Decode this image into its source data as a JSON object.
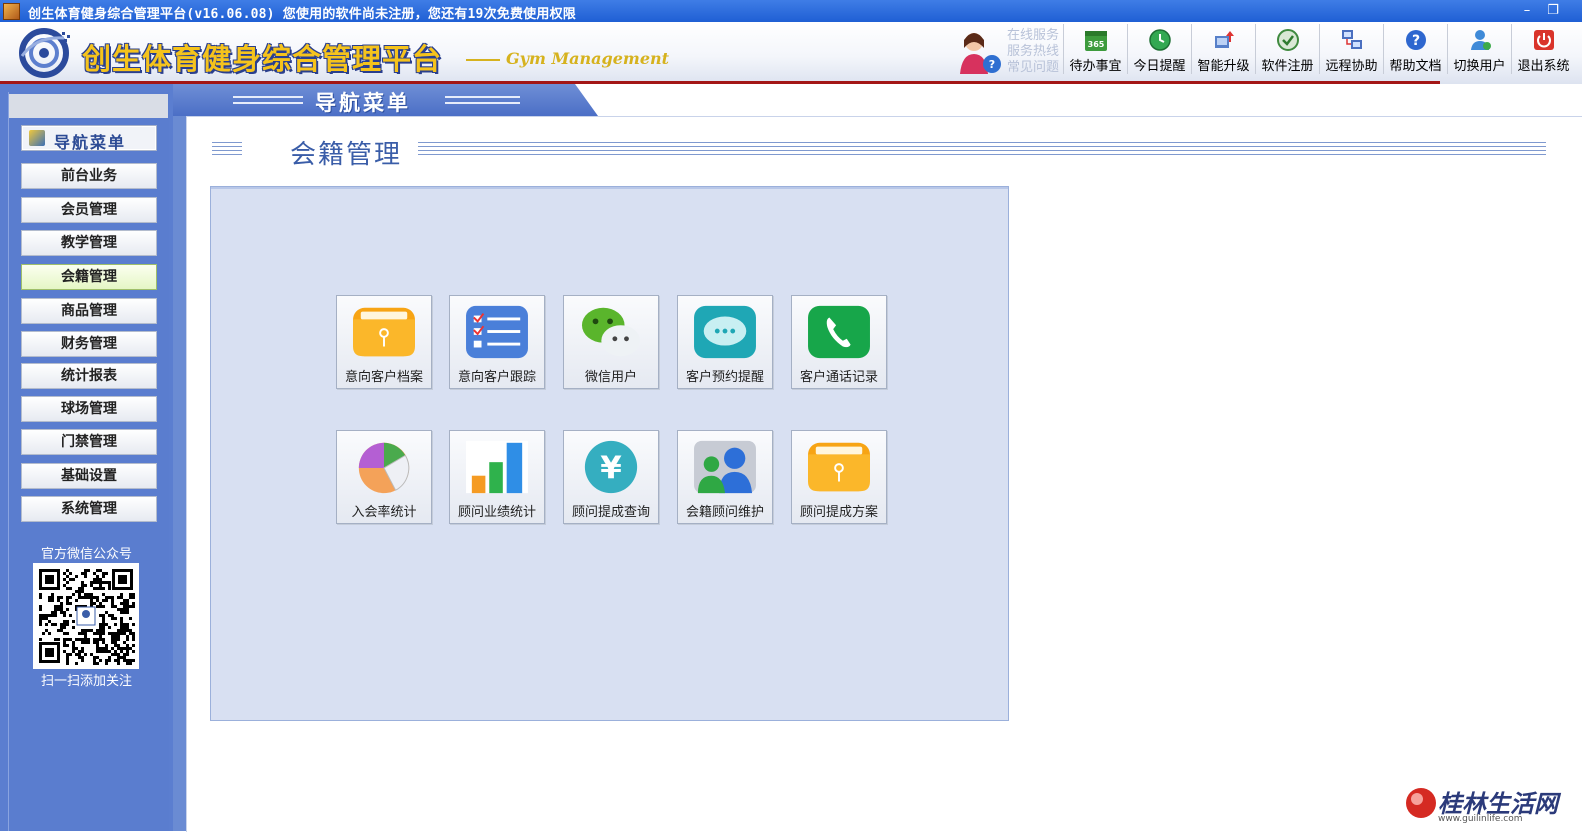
{
  "window": {
    "title": "创生体育健身综合管理平台(v16.06.08)  您使用的软件尚未注册，您还有19次免费使用权限",
    "minimize": "–",
    "restore": "❐"
  },
  "header": {
    "brand": "创生体育健身综合管理平台",
    "brand_sub": "Gym Management",
    "service_lines": [
      "在线服务",
      "服务热线",
      "常见问题"
    ],
    "toolbar": [
      {
        "label": "待办事宜",
        "icon": "calendar-365-icon"
      },
      {
        "label": "今日提醒",
        "icon": "clock-icon"
      },
      {
        "label": "智能升级",
        "icon": "upgrade-icon"
      },
      {
        "label": "软件注册",
        "icon": "register-icon"
      },
      {
        "label": "远程协助",
        "icon": "remote-assist-icon"
      },
      {
        "label": "帮助文档",
        "icon": "help-icon"
      },
      {
        "label": "切换用户",
        "icon": "switch-user-icon"
      },
      {
        "label": "退出系统",
        "icon": "power-icon"
      }
    ]
  },
  "navstrip": {
    "title": "导航菜单"
  },
  "sidebar": {
    "header": "导航菜单",
    "active_index": 3,
    "items": [
      {
        "label": "前台业务"
      },
      {
        "label": "会员管理"
      },
      {
        "label": "教学管理"
      },
      {
        "label": "会籍管理"
      },
      {
        "label": "商品管理"
      },
      {
        "label": "财务管理"
      },
      {
        "label": "统计报表"
      },
      {
        "label": "球场管理"
      },
      {
        "label": "门禁管理"
      },
      {
        "label": "基础设置"
      },
      {
        "label": "系统管理"
      }
    ],
    "qr_caption": "官方微信公众号",
    "qr_sub": "扫一扫添加关注"
  },
  "main": {
    "title": "会籍管理",
    "modules": [
      {
        "label": "意向客户档案",
        "icon": "folder-icon"
      },
      {
        "label": "意向客户跟踪",
        "icon": "checklist-icon"
      },
      {
        "label": "微信用户",
        "icon": "wechat-icon"
      },
      {
        "label": "客户预约提醒",
        "icon": "chat-bubble-icon"
      },
      {
        "label": "客户通话记录",
        "icon": "phone-icon"
      },
      {
        "label": "入会率统计",
        "icon": "pie-chart-icon"
      },
      {
        "label": "顾问业绩统计",
        "icon": "bar-chart-icon"
      },
      {
        "label": "顾问提成查询",
        "icon": "yuan-icon"
      },
      {
        "label": "会籍顾问维护",
        "icon": "users-icon"
      },
      {
        "label": "顾问提成方案",
        "icon": "folder-icon"
      }
    ]
  },
  "watermark": {
    "text": "桂林生活网",
    "url": "www.guilinlife.com"
  },
  "colors": {
    "sidebar_bg": "#5b7ed0",
    "panel_bg": "#d8e0f2",
    "title_blue": "#3a5da8",
    "header_red_line": "#a31616",
    "brand_yellow": "#f5c31c"
  }
}
